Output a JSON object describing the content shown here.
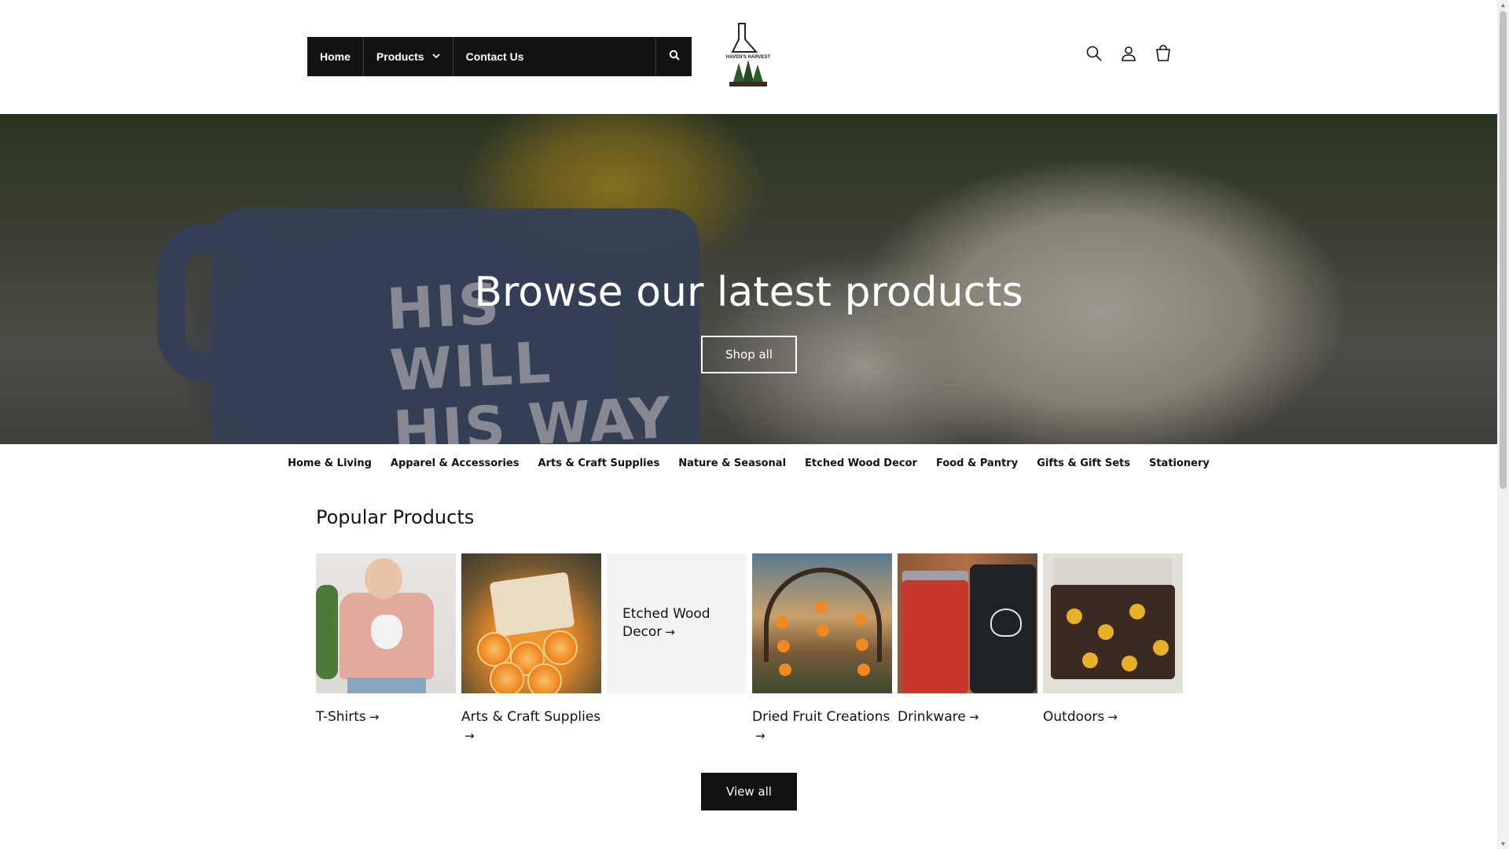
{
  "nav": {
    "home": "Home",
    "products": "Products",
    "contact": "Contact Us",
    "search_icon": "search-icon"
  },
  "logo": {
    "text": "HAVEN'S HARVEST"
  },
  "header_icons": [
    "search-icon",
    "account-icon",
    "cart-icon"
  ],
  "hero": {
    "mug_text": "HIS WILL HIS WAY MY FAITH",
    "title": "Browse our latest products",
    "button": "Shop all"
  },
  "categories": [
    "Home & Living",
    "Apparel & Accessories",
    "Arts & Craft Supplies",
    "Nature & Seasonal",
    "Etched Wood Decor",
    "Food & Pantry",
    "Gifts & Gift Sets",
    "Stationery"
  ],
  "popular": {
    "title": "Popular Products",
    "items": [
      {
        "label": "T-Shirts"
      },
      {
        "label": "Arts & Craft Supplies"
      },
      {
        "label": "Etched Wood Decor"
      },
      {
        "label": "Dried Fruit Creations"
      },
      {
        "label": "Drinkware"
      },
      {
        "label": "Outdoors"
      }
    ],
    "arrow": "→",
    "view_all": "View all"
  },
  "colors": {
    "dark": "#121212",
    "background": "#ffffff",
    "tile": "#f3f3f3"
  }
}
